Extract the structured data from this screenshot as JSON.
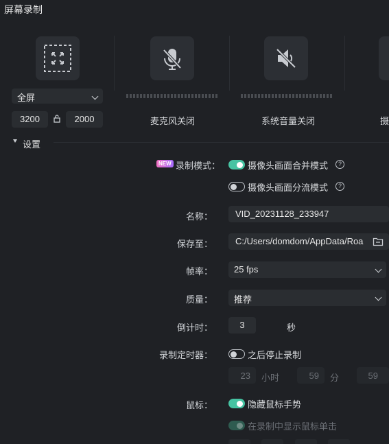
{
  "window": {
    "title": "屏幕录制"
  },
  "sources": {
    "screen": {
      "mode": "全屏",
      "width": "3200",
      "height": "2000",
      "icon": "fullscreen-icon"
    },
    "mic": {
      "caption": "麦克风关闭",
      "icon": "mic-off-icon"
    },
    "system_audio": {
      "caption": "系统音量关闭",
      "icon": "speaker-off-icon"
    },
    "camera": {
      "caption_partial": "摄"
    }
  },
  "settings": {
    "section_label": "设置",
    "record_mode": {
      "label": "录制模式：",
      "badge": "NEW",
      "options": [
        {
          "label": "摄像头画面合并模式",
          "on": true
        },
        {
          "label": "摄像头画面分流模式",
          "on": false
        }
      ]
    },
    "name": {
      "label": "名称：",
      "value": "VID_20231128_233947"
    },
    "save_to": {
      "label": "保存至：",
      "value": "C:/Users/domdom/AppData/Roa"
    },
    "fps": {
      "label": "帧率：",
      "value": "25 fps"
    },
    "quality": {
      "label": "质量：",
      "value": "推荐"
    },
    "countdown": {
      "label": "倒计时：",
      "value": "3",
      "unit": "秒"
    },
    "timer": {
      "label": "录制定时器：",
      "toggle_label": "之后停止录制",
      "on": false,
      "hours": "23",
      "hours_unit": "小时",
      "minutes": "59",
      "minutes_unit": "分",
      "seconds": "59"
    },
    "mouse": {
      "label": "鼠标：",
      "hide_gesture": "隐藏鼠标手势",
      "show_clicks": "在录制中显示鼠标单击"
    }
  },
  "colors": {
    "accent": "#46c3a2",
    "background": "#1f2125",
    "panel": "#2a2d31"
  }
}
